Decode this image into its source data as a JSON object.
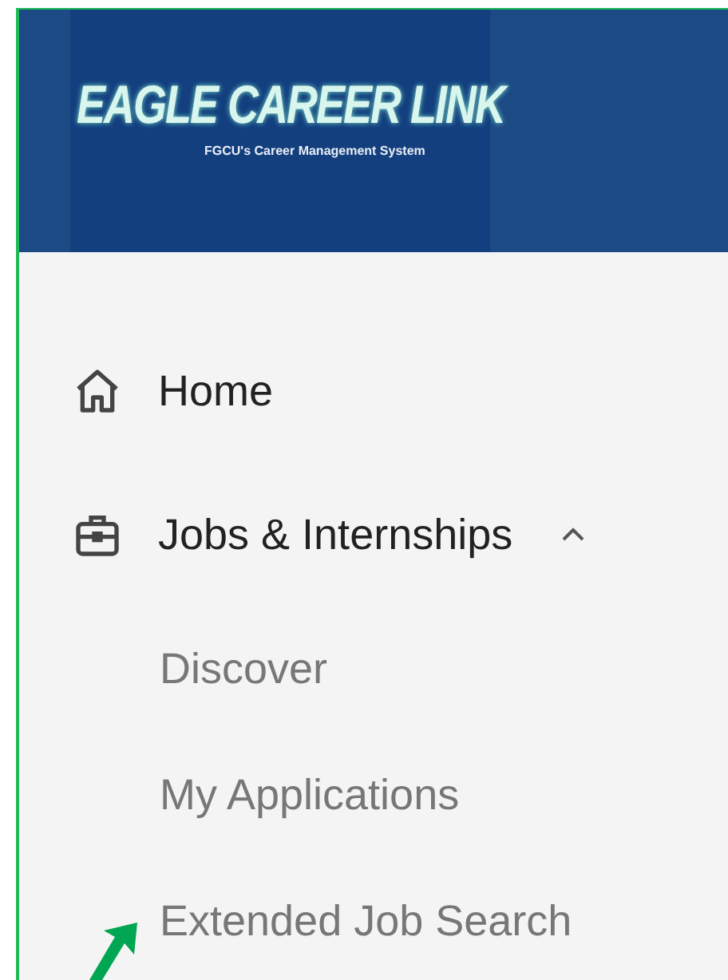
{
  "header": {
    "logo": {
      "title": "EAGLE CAREER LINK",
      "subtitle": "FGCU's Career Management System"
    }
  },
  "nav": [
    {
      "kind": "link",
      "label": "Home"
    },
    {
      "kind": "group",
      "label": "Jobs & Internships",
      "expanded": true,
      "children": [
        {
          "label": "Discover"
        },
        {
          "label": "My Applications"
        },
        {
          "label": "Extended Job Search"
        }
      ]
    }
  ],
  "annotation": {
    "kind": "arrow",
    "color": "#00a651"
  }
}
